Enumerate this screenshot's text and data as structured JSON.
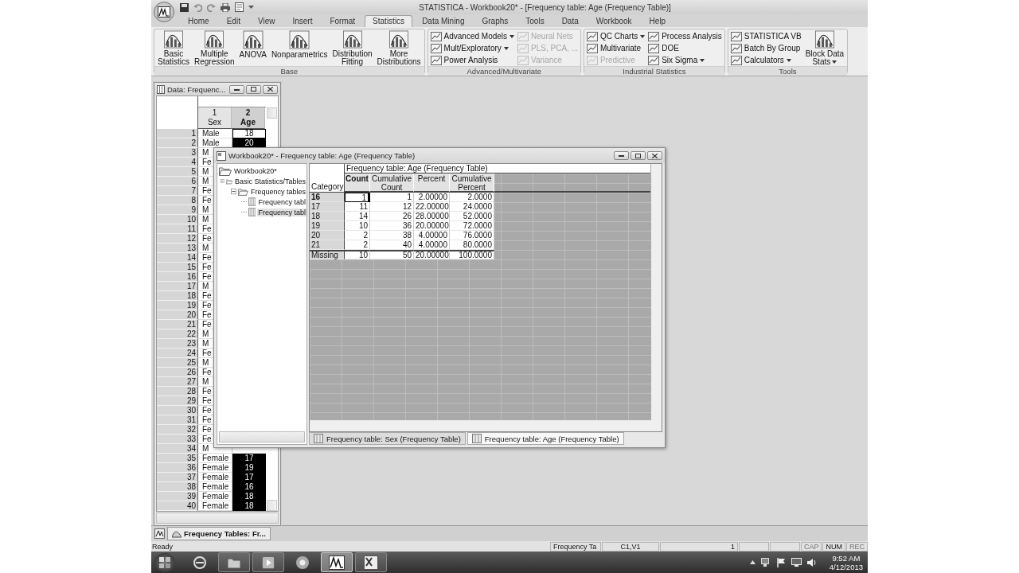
{
  "window": {
    "title": "STATISTICA - Workbook20* - [Frequency table: Age (Frequency Table)]"
  },
  "menu_tabs": [
    {
      "label": "Home",
      "selected": false
    },
    {
      "label": "Edit",
      "selected": false
    },
    {
      "label": "View",
      "selected": false
    },
    {
      "label": "Insert",
      "selected": false
    },
    {
      "label": "Format",
      "selected": false
    },
    {
      "label": "Statistics",
      "selected": true
    },
    {
      "label": "Data Mining",
      "selected": false
    },
    {
      "label": "Graphs",
      "selected": false
    },
    {
      "label": "Tools",
      "selected": false
    },
    {
      "label": "Data",
      "selected": false
    },
    {
      "label": "Workbook",
      "selected": false
    },
    {
      "label": "Help",
      "selected": false
    }
  ],
  "ribbon": {
    "groups": [
      {
        "label": "Base",
        "items": [
          {
            "kind": "large",
            "label": "Basic\nStatistics",
            "dropdown": false,
            "disabled": false
          },
          {
            "kind": "large",
            "label": "Multiple\nRegression",
            "dropdown": false,
            "disabled": false
          },
          {
            "kind": "large",
            "label": "ANOVA",
            "dropdown": false,
            "disabled": false
          },
          {
            "kind": "large",
            "label": "Nonparametrics",
            "dropdown": false,
            "disabled": false
          },
          {
            "kind": "large",
            "label": "Distribution\nFitting",
            "dropdown": false,
            "disabled": false
          },
          {
            "kind": "large",
            "label": "More\nDistributions",
            "dropdown": false,
            "disabled": false
          }
        ]
      },
      {
        "label": "Advanced/Multivariate",
        "items": [
          {
            "kind": "small",
            "label": "Advanced Models",
            "dropdown": true,
            "disabled": false
          },
          {
            "kind": "small",
            "label": "Mult/Exploratory",
            "dropdown": true,
            "disabled": false
          },
          {
            "kind": "small",
            "label": "Power Analysis",
            "dropdown": false,
            "disabled": false
          },
          {
            "kind": "small",
            "label": "Neural Nets",
            "dropdown": false,
            "disabled": true
          },
          {
            "kind": "small",
            "label": "PLS, PCA, ...",
            "dropdown": false,
            "disabled": true
          },
          {
            "kind": "small",
            "label": "Variance",
            "dropdown": false,
            "disabled": true
          }
        ]
      },
      {
        "label": "Industrial Statistics",
        "items": [
          {
            "kind": "small",
            "label": "QC Charts",
            "dropdown": true,
            "disabled": false
          },
          {
            "kind": "small",
            "label": "Multivariate",
            "dropdown": false,
            "disabled": false
          },
          {
            "kind": "small",
            "label": "Predictive",
            "dropdown": false,
            "disabled": true
          },
          {
            "kind": "small",
            "label": "Process Analysis",
            "dropdown": false,
            "disabled": false
          },
          {
            "kind": "small",
            "label": "DOE",
            "dropdown": false,
            "disabled": false
          },
          {
            "kind": "small",
            "label": "Six Sigma",
            "dropdown": true,
            "disabled": false
          }
        ]
      },
      {
        "label": "Tools",
        "items": [
          {
            "kind": "small",
            "label": "STATISTICA VB",
            "dropdown": false,
            "disabled": false
          },
          {
            "kind": "small",
            "label": "Batch By Group",
            "dropdown": false,
            "disabled": false
          },
          {
            "kind": "small",
            "label": "Calculators",
            "dropdown": true,
            "disabled": false
          },
          {
            "kind": "large",
            "label": "Block Data\nStats",
            "dropdown": true,
            "disabled": false
          }
        ]
      }
    ]
  },
  "data_window": {
    "title": "Data: Frequenc...",
    "columns": [
      {
        "number": "1",
        "name": "Sex",
        "selected": false
      },
      {
        "number": "2",
        "name": "Age",
        "selected": true
      }
    ],
    "rows": [
      {
        "number": "1",
        "sex": "Male",
        "age": "18",
        "active": true
      },
      {
        "number": "2",
        "sex": "Male",
        "age": "20",
        "active": false
      },
      {
        "number": "3",
        "sex": "M"
      },
      {
        "number": "4",
        "sex": "Fe"
      },
      {
        "number": "5",
        "sex": "M"
      },
      {
        "number": "6",
        "sex": "M"
      },
      {
        "number": "7",
        "sex": "Fe"
      },
      {
        "number": "8",
        "sex": "Fe"
      },
      {
        "number": "9",
        "sex": "M"
      },
      {
        "number": "10",
        "sex": "M"
      },
      {
        "number": "11",
        "sex": "Fe"
      },
      {
        "number": "12",
        "sex": "Fe"
      },
      {
        "number": "13",
        "sex": "M"
      },
      {
        "number": "14",
        "sex": "Fe"
      },
      {
        "number": "15",
        "sex": "Fe"
      },
      {
        "number": "16",
        "sex": "Fe"
      },
      {
        "number": "17",
        "sex": "M"
      },
      {
        "number": "18",
        "sex": "Fe"
      },
      {
        "number": "19",
        "sex": "Fe"
      },
      {
        "number": "20",
        "sex": "Fe"
      },
      {
        "number": "21",
        "sex": "Fe"
      },
      {
        "number": "22",
        "sex": "M"
      },
      {
        "number": "23",
        "sex": "M"
      },
      {
        "number": "24",
        "sex": "Fe"
      },
      {
        "number": "25",
        "sex": "M"
      },
      {
        "number": "26",
        "sex": "Fe"
      },
      {
        "number": "27",
        "sex": "M"
      },
      {
        "number": "28",
        "sex": "Fe"
      },
      {
        "number": "29",
        "sex": "Fe"
      },
      {
        "number": "30",
        "sex": "Fe"
      },
      {
        "number": "31",
        "sex": "Fe"
      },
      {
        "number": "32",
        "sex": "Fe"
      },
      {
        "number": "33",
        "sex": "Fe"
      },
      {
        "number": "34",
        "sex": "M"
      },
      {
        "number": "35",
        "sex": "Female",
        "age": "17",
        "active": false
      },
      {
        "number": "36",
        "sex": "Female",
        "age": "19",
        "active": false
      },
      {
        "number": "37",
        "sex": "Female",
        "age": "17",
        "active": false
      },
      {
        "number": "38",
        "sex": "Female",
        "age": "16",
        "active": false
      },
      {
        "number": "39",
        "sex": "Female",
        "age": "18",
        "active": false
      },
      {
        "number": "40",
        "sex": "Female",
        "age": "18",
        "active": false
      }
    ]
  },
  "workbook_window": {
    "title": "Workbook20* - Frequency table: Age (Frequency Table)",
    "tree": [
      {
        "label": "Workbook20*",
        "kind": "folder",
        "children": [
          {
            "label": "Basic Statistics/Tables",
            "kind": "folder",
            "expanded": true,
            "children": [
              {
                "label": "Frequency tables",
                "kind": "folder",
                "expanded": true,
                "children": [
                  {
                    "label": "Frequency tabl",
                    "kind": "table",
                    "selected": false
                  },
                  {
                    "label": "Frequency tabl",
                    "kind": "table",
                    "selected": true
                  }
                ]
              }
            ]
          }
        ]
      }
    ],
    "table": {
      "title": "Frequency table: Age (Frequency Table)",
      "row_header": "Category",
      "columns": [
        {
          "label": "Count",
          "selected": true
        },
        {
          "label": "Cumulative\nCount",
          "selected": false
        },
        {
          "label": "Percent",
          "selected": false
        },
        {
          "label": "Cumulative\nPercent",
          "selected": false
        }
      ],
      "rows": [
        {
          "kind": "value",
          "category": "16",
          "active": true,
          "cells": [
            "1",
            "1",
            "2.00000",
            "2.0000"
          ]
        },
        {
          "kind": "value",
          "category": "17",
          "active": false,
          "cells": [
            "11",
            "12",
            "22.00000",
            "24.0000"
          ]
        },
        {
          "kind": "value",
          "category": "18",
          "active": false,
          "cells": [
            "14",
            "26",
            "28.00000",
            "52.0000"
          ]
        },
        {
          "kind": "value",
          "category": "19",
          "active": false,
          "cells": [
            "10",
            "36",
            "20.00000",
            "72.0000"
          ]
        },
        {
          "kind": "value",
          "category": "20",
          "active": false,
          "cells": [
            "2",
            "38",
            "4.00000",
            "76.0000"
          ]
        },
        {
          "kind": "value",
          "category": "21",
          "active": false,
          "cells": [
            "2",
            "40",
            "4.00000",
            "80.0000"
          ]
        },
        {
          "kind": "missing",
          "category": "Missing",
          "active": false,
          "cells": [
            "10",
            "50",
            "20.00000",
            "100.0000"
          ]
        }
      ]
    },
    "sheet_tabs": [
      {
        "label": "Frequency table: Sex (Frequency Table)",
        "selected": false
      },
      {
        "label": "Frequency table: Age (Frequency Table)",
        "selected": true
      }
    ]
  },
  "mdi_tabs": [
    {
      "label": "Frequency Tables: Fr..."
    }
  ],
  "status_bar": {
    "message": "Ready",
    "panes": [
      "Frequency Ta",
      "C1,V1",
      "1"
    ],
    "indicators": [
      {
        "label": "CAP",
        "on": false
      },
      {
        "label": "NUM",
        "on": true
      },
      {
        "label": "REC",
        "on": false
      }
    ]
  },
  "taskbar": {
    "buttons": [
      {
        "running": false,
        "selected": false
      },
      {
        "running": true,
        "selected": false
      },
      {
        "running": true,
        "selected": false
      },
      {
        "running": false,
        "selected": false
      },
      {
        "running": true,
        "selected": true
      },
      {
        "running": true,
        "selected": false
      }
    ],
    "clock": {
      "time": "9:52 AM",
      "date": "4/12/2013"
    }
  }
}
